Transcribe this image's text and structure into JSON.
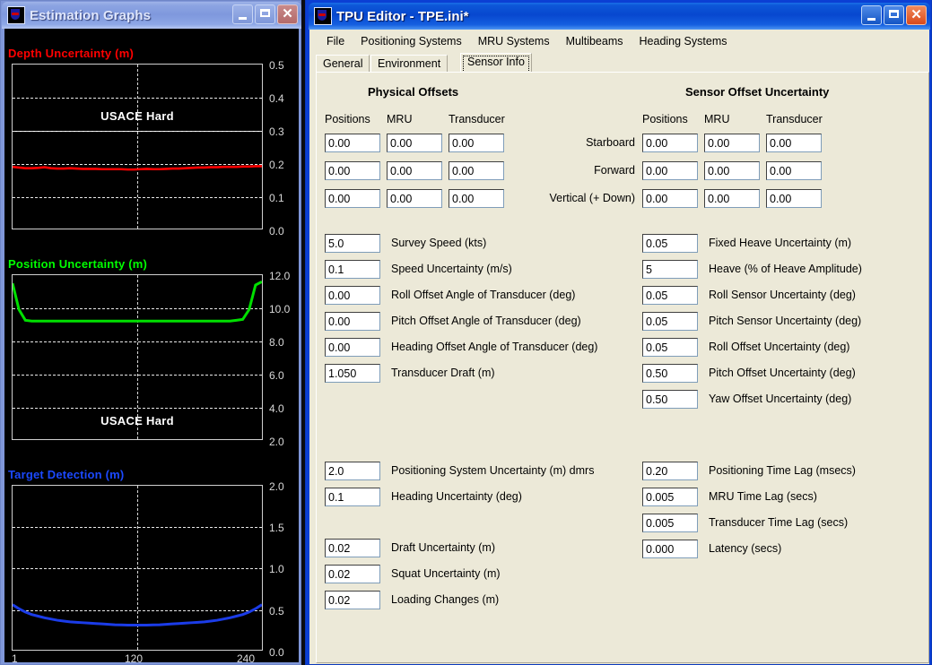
{
  "graphs_window": {
    "title": "Estimation Graphs",
    "icon": "app-icon",
    "buttons": {
      "minimize": "_",
      "maximize": "□",
      "close": "✕"
    },
    "axis_x_labels": [
      "1",
      "120",
      "240"
    ]
  },
  "tpu_window": {
    "title": "TPU Editor - TPE.ini*",
    "icon": "app-icon",
    "buttons": {
      "minimize": "_",
      "maximize": "□",
      "close": "✕"
    },
    "menu": [
      "File",
      "Positioning Systems",
      "MRU Systems",
      "Multibeams",
      "Heading Systems"
    ],
    "tabs": [
      {
        "label": "General",
        "selected": false
      },
      {
        "label": "Environment",
        "selected": false
      },
      {
        "label": "Sensor Info",
        "selected": true
      }
    ],
    "sections": {
      "physical_offsets": {
        "heading": "Physical Offsets",
        "columns": [
          "Positions",
          "MRU",
          "Transducer"
        ],
        "rows": [
          {
            "label": "Starboard",
            "values": [
              "0.00",
              "0.00",
              "0.00"
            ]
          },
          {
            "label": "Forward",
            "values": [
              "0.00",
              "0.00",
              "0.00"
            ]
          },
          {
            "label": "Vertical (+ Down)",
            "values": [
              "0.00",
              "0.00",
              "0.00"
            ]
          }
        ]
      },
      "sensor_offset_uncertainty": {
        "heading": "Sensor Offset Uncertainty",
        "columns": [
          "Positions",
          "MRU",
          "Transducer"
        ],
        "rows": [
          {
            "label": "Starboard",
            "values": [
              "0.00",
              "0.00",
              "0.00"
            ]
          },
          {
            "label": "Forward",
            "values": [
              "0.00",
              "0.00",
              "0.00"
            ]
          },
          {
            "label": "Vertical (+ Down)",
            "values": [
              "0.00",
              "0.00",
              "0.00"
            ]
          }
        ]
      }
    },
    "left_fields_group1": [
      {
        "value": "5.0",
        "label": "Survey Speed (kts)"
      },
      {
        "value": "0.1",
        "label": "Speed Uncertainty (m/s)"
      },
      {
        "value": "0.00",
        "label": "Roll Offset Angle of Transducer (deg)"
      },
      {
        "value": "0.00",
        "label": "Pitch Offset Angle of Transducer (deg)"
      },
      {
        "value": "0.00",
        "label": "Heading Offset Angle of Transducer (deg)"
      },
      {
        "value": "1.050",
        "label": "Transducer Draft (m)"
      }
    ],
    "right_fields_group1": [
      {
        "value": "0.05",
        "label": "Fixed Heave Uncertainty (m)"
      },
      {
        "value": "5",
        "label": "Heave (% of Heave Amplitude)"
      },
      {
        "value": "0.05",
        "label": "Roll Sensor Uncertainty (deg)"
      },
      {
        "value": "0.05",
        "label": "Pitch Sensor Uncertainty (deg)"
      },
      {
        "value": "0.05",
        "label": "Roll Offset Uncertainty (deg)"
      },
      {
        "value": "0.50",
        "label": "Pitch Offset Uncertainty (deg)"
      },
      {
        "value": "0.50",
        "label": "Yaw Offset Uncertainty (deg)"
      }
    ],
    "left_fields_group2": [
      {
        "value": "2.0",
        "label": "Positioning System Uncertainty (m) dmrs"
      },
      {
        "value": "0.1",
        "label": "Heading Uncertainty (deg)"
      }
    ],
    "left_fields_group3": [
      {
        "value": "0.02",
        "label": "Draft Uncertainty (m)"
      },
      {
        "value": "0.02",
        "label": "Squat Uncertainty (m)"
      },
      {
        "value": "0.02",
        "label": "Loading Changes (m)"
      }
    ],
    "right_fields_group2": [
      {
        "value": "0.20",
        "label": "Positioning Time Lag (msecs)"
      },
      {
        "value": "0.005",
        "label": "MRU Time Lag (secs)"
      },
      {
        "value": "0.005",
        "label": "Transducer Time Lag (secs)"
      },
      {
        "value": "0.000",
        "label": "Latency (secs)"
      }
    ]
  },
  "chart_data": [
    {
      "type": "line",
      "title": "Depth Uncertainty (m)",
      "title_color": "#ff0000",
      "series_color": "#ff0000",
      "xlabel": "",
      "ylabel": "",
      "x": [
        1,
        240
      ],
      "xlim": [
        1,
        240
      ],
      "ylim": [
        0.0,
        0.5
      ],
      "yticks": [
        "0.5",
        "0.4",
        "0.3",
        "0.2",
        "0.1",
        "0.0"
      ],
      "gridlines_y": [
        0.1,
        0.2,
        0.3,
        0.4
      ],
      "solid_line_y": 0.3,
      "gridline_x": 120,
      "annotation": "USACE Hard",
      "annotation_y": 0.33,
      "values_note": "Near-flat trace around 0.18-0.19 with small jitter across beam index 1..240",
      "values": [
        0.188,
        0.186,
        0.184,
        0.184,
        0.185,
        0.187,
        0.184,
        0.183,
        0.183,
        0.184,
        0.183,
        0.182,
        0.182,
        0.182,
        0.181,
        0.181,
        0.181,
        0.181,
        0.18,
        0.18,
        0.181,
        0.182,
        0.181,
        0.181,
        0.182,
        0.183,
        0.183,
        0.184,
        0.185,
        0.186,
        0.186,
        0.187,
        0.187,
        0.188,
        0.188,
        0.188,
        0.189,
        0.189,
        0.19,
        0.19
      ]
    },
    {
      "type": "line",
      "title": "Position Uncertainty (m)",
      "title_color": "#00ff00",
      "series_color": "#00e000",
      "xlabel": "",
      "ylabel": "",
      "xlim": [
        1,
        240
      ],
      "ylim": [
        2.0,
        12.0
      ],
      "yticks": [
        "12.0",
        "10.0",
        "8.0",
        "6.0",
        "4.0",
        "2.0"
      ],
      "gridlines_y": [
        4.0,
        6.0,
        8.0,
        10.0
      ],
      "gridline_x": 120,
      "annotation": "USACE Hard",
      "annotation_y": 3.1,
      "values_note": "Flat plateau at about 9.2 m, rising steeply to about 11.5 m at both outer beams",
      "values": [
        11.5,
        9.9,
        9.25,
        9.2,
        9.2,
        9.2,
        9.2,
        9.2,
        9.2,
        9.2,
        9.2,
        9.2,
        9.2,
        9.2,
        9.2,
        9.2,
        9.2,
        9.2,
        9.2,
        9.2,
        9.2,
        9.2,
        9.2,
        9.2,
        9.2,
        9.2,
        9.2,
        9.2,
        9.2,
        9.2,
        9.2,
        9.2,
        9.2,
        9.2,
        9.2,
        9.25,
        9.3,
        9.9,
        11.4,
        11.6
      ]
    },
    {
      "type": "line",
      "title": "Target Detection (m)",
      "title_color": "#1b49ff",
      "series_color": "#1b3ce8",
      "xlabel": "",
      "ylabel": "",
      "xlim": [
        1,
        240
      ],
      "ylim": [
        0.0,
        2.0
      ],
      "yticks": [
        "2.0",
        "1.5",
        "1.0",
        "0.5",
        "0.0"
      ],
      "gridlines_y": [
        0.5,
        1.0,
        1.5
      ],
      "gridline_x": 120,
      "annotation": "",
      "values_note": "Shallow U-shaped curve, 0.55 at edges down to about 0.30 at nadir",
      "values": [
        0.55,
        0.5,
        0.46,
        0.43,
        0.41,
        0.39,
        0.375,
        0.36,
        0.35,
        0.34,
        0.335,
        0.33,
        0.325,
        0.32,
        0.315,
        0.31,
        0.305,
        0.303,
        0.301,
        0.3,
        0.3,
        0.301,
        0.303,
        0.305,
        0.31,
        0.315,
        0.32,
        0.325,
        0.33,
        0.335,
        0.34,
        0.35,
        0.36,
        0.375,
        0.39,
        0.41,
        0.43,
        0.46,
        0.5,
        0.55
      ]
    }
  ]
}
